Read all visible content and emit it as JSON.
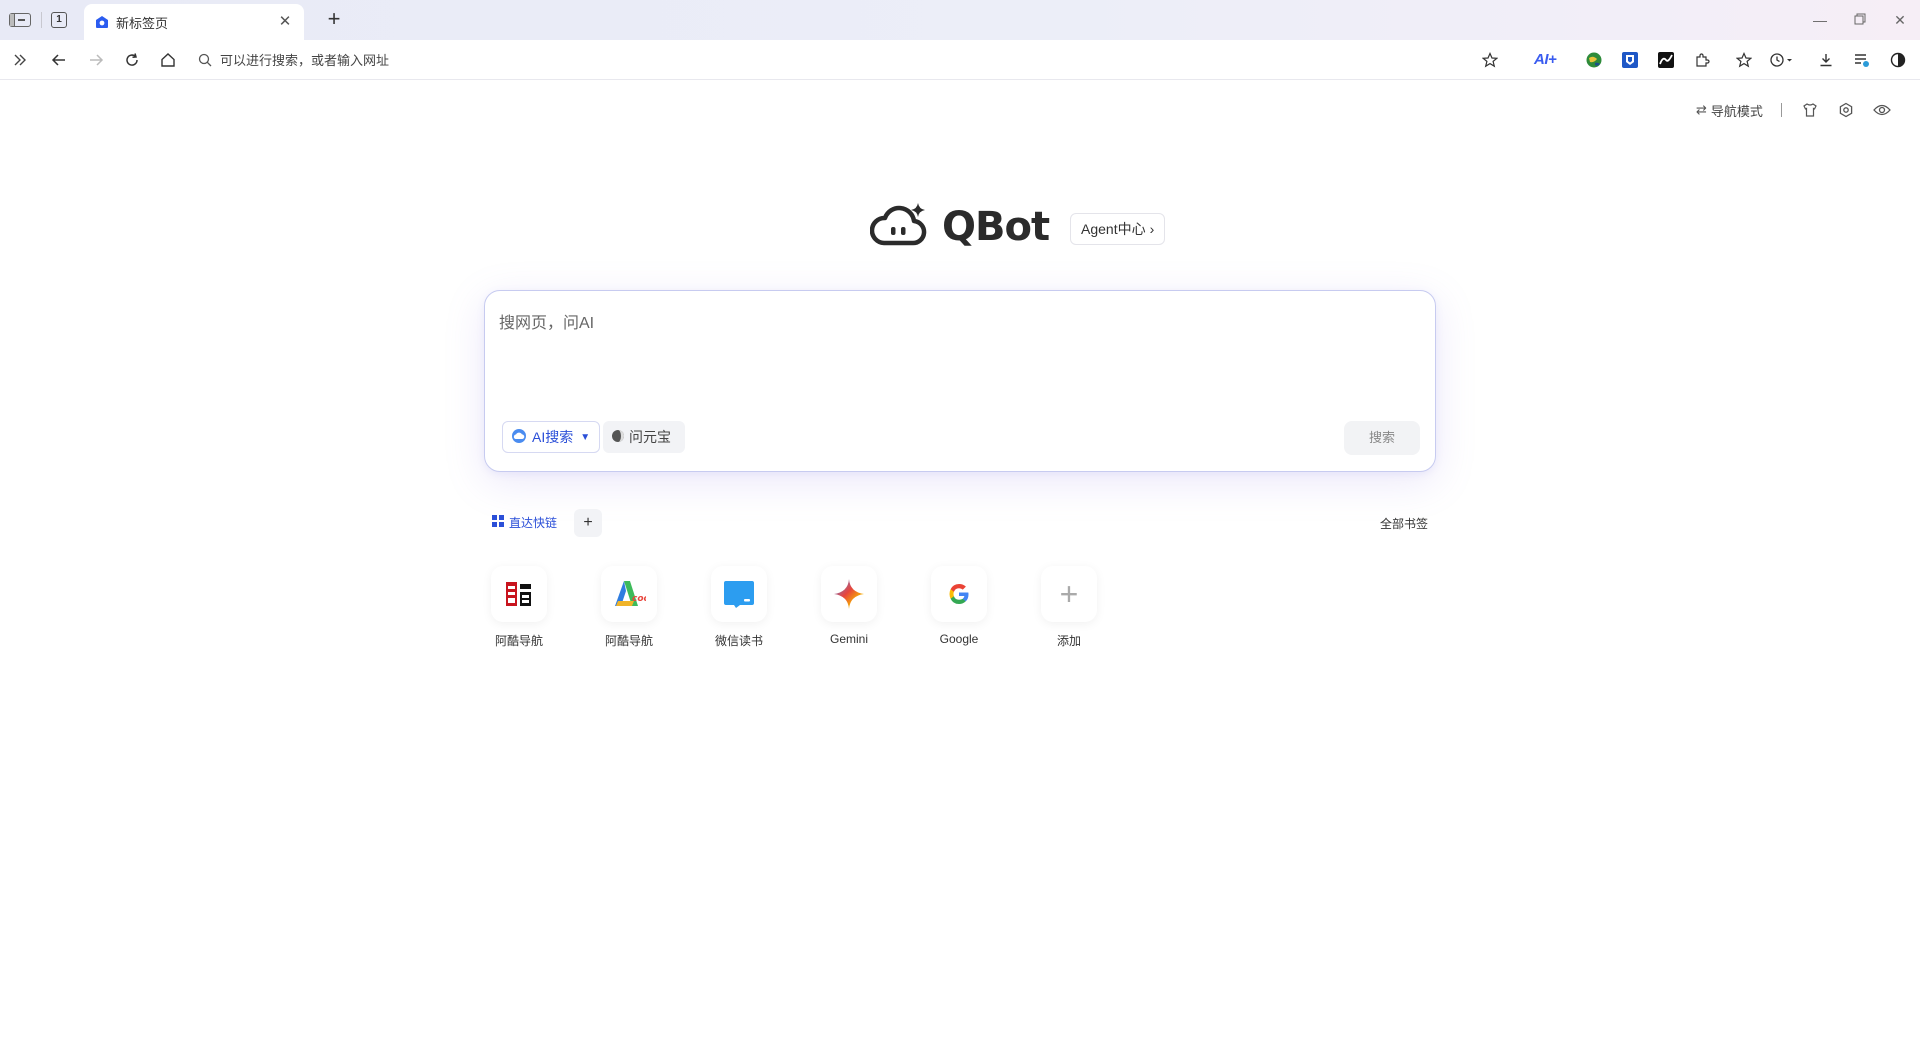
{
  "tabstrip": {
    "tab_count": "1",
    "active_tab_title": "新标签页"
  },
  "toolbar": {
    "address_placeholder": "可以进行搜索，或者输入网址",
    "ai_plus_label": "AI+"
  },
  "page_controls": {
    "nav_mode_label": "导航模式"
  },
  "logo": {
    "text": "QBot",
    "agent_button_label": "Agent中心"
  },
  "search": {
    "placeholder": "搜网页，问AI",
    "ai_search_label": "AI搜索",
    "yuanbao_label": "问元宝",
    "submit_label": "搜索"
  },
  "quick_links": {
    "tab_label": "直达快链",
    "add_label": "+",
    "all_bookmarks_label": "全部书签",
    "items": [
      {
        "label": "阿酷导航",
        "icon": "kuai-logo-icon"
      },
      {
        "label": "阿酷导航",
        "icon": "acool-logo-icon"
      },
      {
        "label": "微信读书",
        "icon": "weread-logo-icon"
      },
      {
        "label": "Gemini",
        "icon": "gemini-logo-icon"
      },
      {
        "label": "Google",
        "icon": "google-logo-icon"
      },
      {
        "label": "添加",
        "icon": "plus-icon"
      }
    ]
  },
  "colors": {
    "accent": "#2b4fd8",
    "search_border": "#c7cbf0",
    "tabstrip_bg": "#e8eaf6"
  }
}
